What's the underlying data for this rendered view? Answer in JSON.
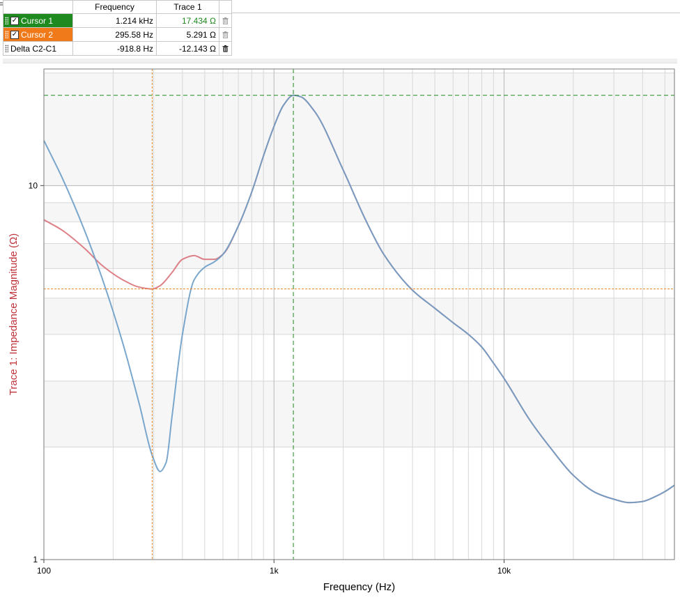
{
  "cursor_table": {
    "headers": [
      "",
      "Frequency",
      "Trace 1"
    ],
    "rows": [
      {
        "name": "Cursor 1",
        "checked": true,
        "frequency": "1.214 kHz",
        "value": "17.434 Ω",
        "color": "#1f8a1f"
      },
      {
        "name": "Cursor 2",
        "checked": true,
        "frequency": "295.58 Hz",
        "value": "5.291 Ω",
        "color": "#f07a1a"
      },
      {
        "name": "Delta C2-C1",
        "checked": false,
        "frequency": "-918.8 Hz",
        "value": "-12.143 Ω",
        "color": ""
      }
    ]
  },
  "chart_data": {
    "type": "line",
    "xlabel": "Frequency (Hz)",
    "ylabel": "Trace 1: Impedance Magnitude (Ω)",
    "x_scale": "log",
    "y_scale": "log",
    "xlim": [
      100,
      55000
    ],
    "ylim": [
      1,
      20.5
    ],
    "x_ticks": [
      {
        "value": 100,
        "label": "100"
      },
      {
        "value": 1000,
        "label": "1k"
      },
      {
        "value": 10000,
        "label": "10k"
      }
    ],
    "y_ticks": [
      {
        "value": 1,
        "label": "1"
      },
      {
        "value": 10,
        "label": "10"
      }
    ],
    "grid": true,
    "series": [
      {
        "color": "#d9727a",
        "x": [
          100,
          120,
          150,
          180,
          220,
          260,
          295.6,
          320,
          360,
          400,
          450,
          500,
          550,
          600,
          700,
          800,
          900,
          1000,
          1100,
          1214,
          1300,
          1500,
          2000,
          2500,
          3000,
          4000,
          5000,
          6000,
          7000,
          8000,
          9000,
          10000,
          13000,
          16000,
          20000,
          25000,
          30000,
          35000,
          40000,
          45000,
          50000,
          55000
        ],
        "y": [
          8.1,
          7.6,
          6.8,
          6.1,
          5.6,
          5.35,
          5.29,
          5.4,
          5.85,
          6.35,
          6.5,
          6.35,
          6.35,
          6.55,
          7.8,
          9.6,
          12.0,
          14.4,
          16.4,
          17.43,
          17.3,
          15.8,
          11.0,
          8.1,
          6.55,
          5.25,
          4.7,
          4.3,
          4.0,
          3.7,
          3.35,
          3.05,
          2.35,
          1.98,
          1.68,
          1.51,
          1.45,
          1.42,
          1.43,
          1.47,
          1.52,
          1.58
        ]
      },
      {
        "color": "#6b9dc8",
        "x": [
          100,
          120,
          150,
          180,
          220,
          260,
          295.6,
          320,
          340,
          360,
          400,
          450,
          500,
          550,
          600,
          700,
          800,
          900,
          1000,
          1100,
          1214,
          1300,
          1500,
          2000,
          2500,
          3000,
          4000,
          5000,
          6000,
          7000,
          8000,
          9000,
          10000,
          13000,
          16000,
          20000,
          25000,
          30000,
          35000,
          40000,
          45000,
          50000,
          55000
        ],
        "y": [
          13.2,
          10.5,
          7.6,
          5.6,
          3.8,
          2.6,
          1.9,
          1.72,
          1.82,
          2.4,
          4.0,
          5.6,
          6.05,
          6.25,
          6.55,
          7.8,
          9.6,
          12.0,
          14.4,
          16.4,
          17.43,
          17.3,
          15.8,
          11.0,
          8.1,
          6.55,
          5.25,
          4.7,
          4.3,
          4.0,
          3.7,
          3.35,
          3.05,
          2.35,
          1.98,
          1.68,
          1.51,
          1.45,
          1.42,
          1.43,
          1.47,
          1.52,
          1.58
        ]
      }
    ],
    "cursors": [
      {
        "x": 1214,
        "y": 17.434,
        "color": "#1e8a1e"
      },
      {
        "x": 295.58,
        "y": 5.291,
        "color": "#e8851c"
      }
    ]
  },
  "colors": {
    "ylabel": "#c0343c",
    "plot_border": "#7a7a7a",
    "grid_major": "#b8b8b8",
    "grid_minor": "#d8d8d8",
    "band": "#f6f6f6"
  },
  "icons": {
    "drag_handle": "grip-dots-icon",
    "checkbox": "check-icon",
    "delete": "trash-icon"
  }
}
